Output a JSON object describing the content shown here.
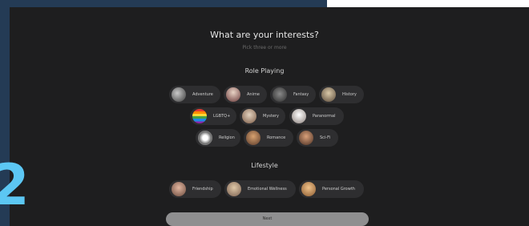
{
  "header": {
    "title": "What are your interests?",
    "subtitle": "Pick three or more"
  },
  "slide_number": "2",
  "sections": [
    {
      "label": "Role Playing",
      "chips": [
        {
          "label": "Adventure",
          "icon": "adventure-thumbnail"
        },
        {
          "label": "Anime",
          "icon": "anime-thumbnail"
        },
        {
          "label": "Fantasy",
          "icon": "fantasy-thumbnail"
        },
        {
          "label": "History",
          "icon": "history-thumbnail"
        },
        {
          "label": "LGBTQ+",
          "icon": "rainbow-flag-icon"
        },
        {
          "label": "Mystery",
          "icon": "mystery-thumbnail"
        },
        {
          "label": "Paranormal",
          "icon": "paranormal-thumbnail"
        },
        {
          "label": "Religion",
          "icon": "religion-thumbnail"
        },
        {
          "label": "Romance",
          "icon": "romance-thumbnail"
        },
        {
          "label": "Sci-Fi",
          "icon": "sci-fi-thumbnail"
        }
      ]
    },
    {
      "label": "Lifestyle",
      "chips": [
        {
          "label": "Friendship",
          "icon": "friendship-thumbnail"
        },
        {
          "label": "Emotional Wellness",
          "icon": "emotional-wellness-thumbnail"
        },
        {
          "label": "Personal Growth",
          "icon": "personal-growth-thumbnail"
        }
      ]
    }
  ],
  "actions": {
    "next_label": "Next"
  },
  "colors": {
    "background": "#243b55",
    "panel": "#1e1e1f",
    "chip": "#2e2e30",
    "accent_number": "#5cc7f3",
    "button": "#8f8f90"
  }
}
